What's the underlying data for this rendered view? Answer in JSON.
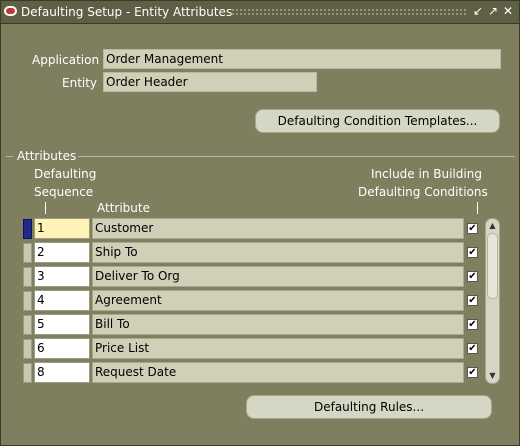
{
  "window": {
    "title": "Defaulting Setup - Entity Attributes",
    "controls": {
      "minimize": "↙",
      "maximize": "↗",
      "close": "✕"
    }
  },
  "header": {
    "application_label": "Application",
    "application_value": "Order Management",
    "entity_label": "Entity",
    "entity_value": "Order Header"
  },
  "buttons": {
    "defaulting_condition_templates": "Defaulting Condition Templates...",
    "defaulting_rules": "Defaulting Rules..."
  },
  "attributes": {
    "section_label": "Attributes",
    "col_sequence_line1": "Defaulting",
    "col_sequence_line2": "Sequence",
    "col_attribute": "Attribute",
    "col_include_line1": "Include in Building",
    "col_include_line2": "Defaulting Conditions",
    "rows": [
      {
        "sequence": "1",
        "attribute": "Customer",
        "include": "✔"
      },
      {
        "sequence": "2",
        "attribute": "Ship To",
        "include": "✔"
      },
      {
        "sequence": "3",
        "attribute": "Deliver To Org",
        "include": "✔"
      },
      {
        "sequence": "4",
        "attribute": "Agreement",
        "include": "✔"
      },
      {
        "sequence": "5",
        "attribute": "Bill To",
        "include": "✔"
      },
      {
        "sequence": "6",
        "attribute": "Price List",
        "include": "✔"
      },
      {
        "sequence": "8",
        "attribute": "Request Date",
        "include": "✔"
      }
    ]
  },
  "scrollbar": {
    "up": "▲",
    "down": "▼"
  }
}
